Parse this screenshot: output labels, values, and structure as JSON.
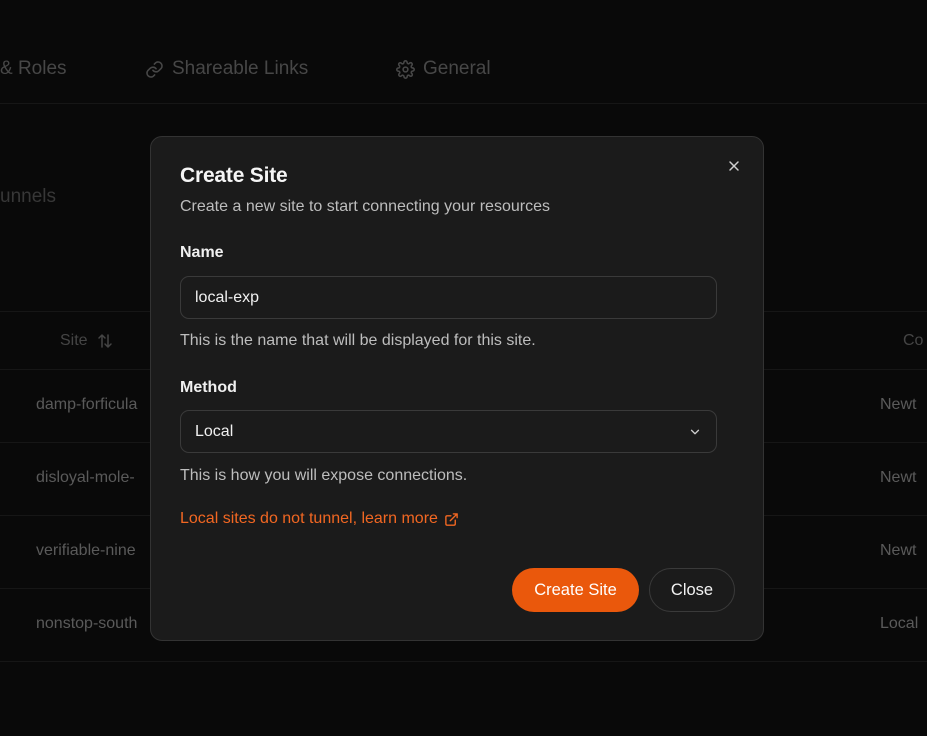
{
  "tabs": [
    {
      "label": "& Roles",
      "icon": "users-icon"
    },
    {
      "label": "Shareable Links",
      "icon": "link-icon"
    },
    {
      "label": "General",
      "icon": "gear-icon"
    }
  ],
  "section": {
    "title": "unnels"
  },
  "table": {
    "headers": {
      "site": "Site",
      "mid": "↓",
      "connection": "Co"
    },
    "rows": [
      {
        "site": "damp-forficula",
        "type": "Newt"
      },
      {
        "site": "disloyal-mole-",
        "type": "Newt"
      },
      {
        "site": "verifiable-nine",
        "type": "Newt"
      },
      {
        "site": "nonstop-south",
        "type": "Local"
      }
    ]
  },
  "modal": {
    "title": "Create Site",
    "description": "Create a new site to start connecting your resources",
    "name": {
      "label": "Name",
      "value": "local-exp",
      "help": "This is the name that will be displayed for this site."
    },
    "method": {
      "label": "Method",
      "value": "Local",
      "help": "This is how you will expose connections."
    },
    "learn_more": "Local sites do not tunnel, learn more",
    "create_label": "Create Site",
    "close_label": "Close"
  },
  "colors": {
    "accent": "#ea580c",
    "link": "#f26722",
    "background": "#0e0e0e",
    "modal": "#1b1b1b"
  }
}
